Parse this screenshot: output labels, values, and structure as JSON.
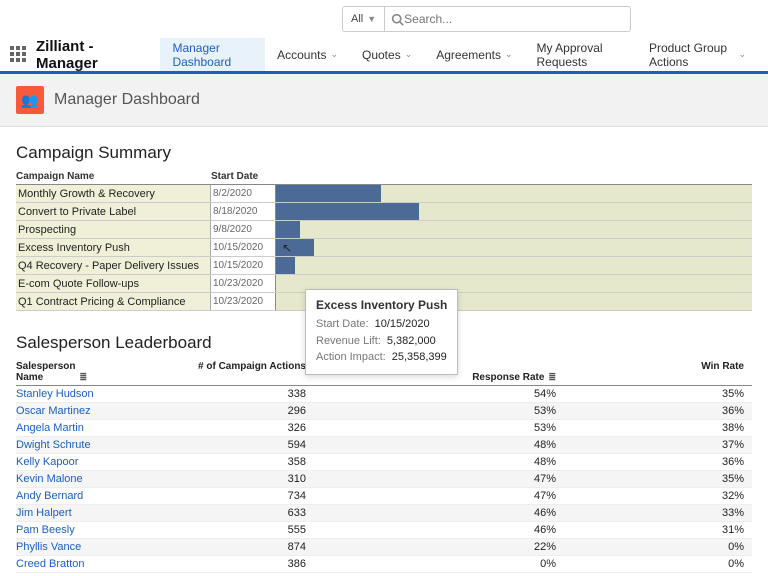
{
  "topbar": {
    "scope": "All",
    "search_placeholder": "Search..."
  },
  "app_name": "Zilliant - Manager",
  "nav": [
    {
      "label": "Manager Dashboard",
      "active": true,
      "chev": false
    },
    {
      "label": "Accounts",
      "active": false,
      "chev": true
    },
    {
      "label": "Quotes",
      "active": false,
      "chev": true
    },
    {
      "label": "Agreements",
      "active": false,
      "chev": true
    },
    {
      "label": "My Approval Requests",
      "active": false,
      "chev": false
    },
    {
      "label": "Product Group Actions",
      "active": false,
      "chev": true
    }
  ],
  "page_title": "Manager Dashboard",
  "campaign": {
    "title": "Campaign Summary",
    "cols": {
      "name": "Campaign Name",
      "date": "Start Date"
    },
    "rows": [
      {
        "name": "Monthly Growth & Recovery",
        "date": "8/2/2020",
        "bar": 22
      },
      {
        "name": "Convert to Private Label",
        "date": "8/18/2020",
        "bar": 30
      },
      {
        "name": "Prospecting",
        "date": "9/8/2020",
        "bar": 5
      },
      {
        "name": "Excess Inventory Push",
        "date": "10/15/2020",
        "bar": 8,
        "hover": true
      },
      {
        "name": "Q4 Recovery - Paper Delivery Issues",
        "date": "10/15/2020",
        "bar": 4
      },
      {
        "name": "E-com Quote Follow-ups",
        "date": "10/23/2020",
        "bar": 0
      },
      {
        "name": "Q1 Contract Pricing & Compliance",
        "date": "10/23/2020",
        "bar": 0
      }
    ]
  },
  "tooltip": {
    "title": "Excess Inventory Push",
    "rows": [
      {
        "label": "Start Date:",
        "value": "10/15/2020"
      },
      {
        "label": "Revenue Lift:",
        "value": "5,382,000"
      },
      {
        "label": "Action Impact:",
        "value": "25,358,399"
      }
    ]
  },
  "leaderboard": {
    "title": "Salesperson Leaderboard",
    "cols": {
      "name": "Salesperson\nName",
      "actions": "# of Campaign Actions",
      "rate": "Response Rate",
      "win": "Win Rate"
    },
    "rows": [
      {
        "name": "Stanley Hudson",
        "actions": "338",
        "rate": "54%",
        "win": "35%"
      },
      {
        "name": "Oscar Martinez",
        "actions": "296",
        "rate": "53%",
        "win": "36%"
      },
      {
        "name": "Angela Martin",
        "actions": "326",
        "rate": "53%",
        "win": "38%"
      },
      {
        "name": "Dwight Schrute",
        "actions": "594",
        "rate": "48%",
        "win": "37%"
      },
      {
        "name": "Kelly Kapoor",
        "actions": "358",
        "rate": "48%",
        "win": "36%"
      },
      {
        "name": "Kevin Malone",
        "actions": "310",
        "rate": "47%",
        "win": "35%"
      },
      {
        "name": "Andy Bernard",
        "actions": "734",
        "rate": "47%",
        "win": "32%"
      },
      {
        "name": "Jim Halpert",
        "actions": "633",
        "rate": "46%",
        "win": "33%"
      },
      {
        "name": "Pam Beesly",
        "actions": "555",
        "rate": "46%",
        "win": "31%"
      },
      {
        "name": "Phyllis Vance",
        "actions": "874",
        "rate": "22%",
        "win": "0%"
      },
      {
        "name": "Creed Bratton",
        "actions": "386",
        "rate": "0%",
        "win": "0%"
      }
    ]
  },
  "chart_data": {
    "type": "bar",
    "orientation": "horizontal",
    "categories": [
      "Monthly Growth & Recovery",
      "Convert to Private Label",
      "Prospecting",
      "Excess Inventory Push",
      "Q4 Recovery - Paper Delivery Issues",
      "E-com Quote Follow-ups",
      "Q1 Contract Pricing & Compliance"
    ],
    "values": [
      22,
      30,
      5,
      8,
      4,
      0,
      0
    ],
    "note": "bar values are relative percentages of visible track width; absolute units not labeled on chart"
  }
}
